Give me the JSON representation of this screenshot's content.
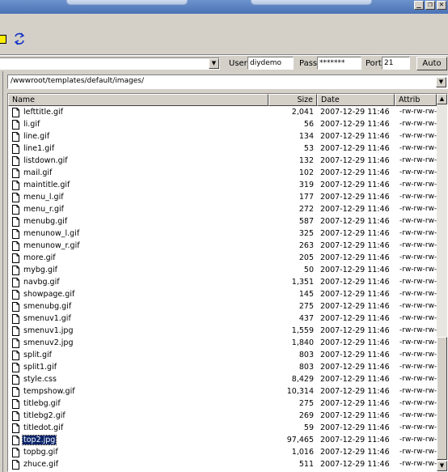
{
  "window": {
    "buttons": {
      "minimize": "_",
      "restore": "❐",
      "close": "✕"
    }
  },
  "connection": {
    "user_label": "User",
    "user_value": "diydemo",
    "pass_label": "Pass",
    "pass_value": "*******",
    "port_label": "Port",
    "port_value": "21",
    "auto_label": "Auto"
  },
  "path": {
    "value": "/wwwroot/templates/default/images/"
  },
  "columns": {
    "name": "Name",
    "size": "Size",
    "date": "Date",
    "attrib": "Attrib"
  },
  "files": [
    {
      "name": "lefttitle.gif",
      "size": "2,041",
      "date": "2007-12-29 11:46",
      "attrib": "-rw-rw-rw-"
    },
    {
      "name": "li.gif",
      "size": "56",
      "date": "2007-12-29 11:46",
      "attrib": "-rw-rw-rw-"
    },
    {
      "name": "line.gif",
      "size": "134",
      "date": "2007-12-29 11:46",
      "attrib": "-rw-rw-rw-"
    },
    {
      "name": "line1.gif",
      "size": "53",
      "date": "2007-12-29 11:46",
      "attrib": "-rw-rw-rw-"
    },
    {
      "name": "listdown.gif",
      "size": "132",
      "date": "2007-12-29 11:46",
      "attrib": "-rw-rw-rw-"
    },
    {
      "name": "mail.gif",
      "size": "102",
      "date": "2007-12-29 11:46",
      "attrib": "-rw-rw-rw-"
    },
    {
      "name": "maintitle.gif",
      "size": "319",
      "date": "2007-12-29 11:46",
      "attrib": "-rw-rw-rw-"
    },
    {
      "name": "menu_l.gif",
      "size": "177",
      "date": "2007-12-29 11:46",
      "attrib": "-rw-rw-rw-"
    },
    {
      "name": "menu_r.gif",
      "size": "272",
      "date": "2007-12-29 11:46",
      "attrib": "-rw-rw-rw-"
    },
    {
      "name": "menubg.gif",
      "size": "587",
      "date": "2007-12-29 11:46",
      "attrib": "-rw-rw-rw-"
    },
    {
      "name": "menunow_l.gif",
      "size": "325",
      "date": "2007-12-29 11:46",
      "attrib": "-rw-rw-rw-"
    },
    {
      "name": "menunow_r.gif",
      "size": "263",
      "date": "2007-12-29 11:46",
      "attrib": "-rw-rw-rw-"
    },
    {
      "name": "more.gif",
      "size": "205",
      "date": "2007-12-29 11:46",
      "attrib": "-rw-rw-rw-"
    },
    {
      "name": "mybg.gif",
      "size": "50",
      "date": "2007-12-29 11:46",
      "attrib": "-rw-rw-rw-"
    },
    {
      "name": "navbg.gif",
      "size": "1,351",
      "date": "2007-12-29 11:46",
      "attrib": "-rw-rw-rw-"
    },
    {
      "name": "showpage.gif",
      "size": "145",
      "date": "2007-12-29 11:46",
      "attrib": "-rw-rw-rw-"
    },
    {
      "name": "smenubg.gif",
      "size": "275",
      "date": "2007-12-29 11:46",
      "attrib": "-rw-rw-rw-"
    },
    {
      "name": "smenuv1.gif",
      "size": "437",
      "date": "2007-12-29 11:46",
      "attrib": "-rw-rw-rw-"
    },
    {
      "name": "smenuv1.jpg",
      "size": "1,559",
      "date": "2007-12-29 11:46",
      "attrib": "-rw-rw-rw-"
    },
    {
      "name": "smenuv2.jpg",
      "size": "1,840",
      "date": "2007-12-29 11:46",
      "attrib": "-rw-rw-rw-"
    },
    {
      "name": "split.gif",
      "size": "803",
      "date": "2007-12-29 11:46",
      "attrib": "-rw-rw-rw-"
    },
    {
      "name": "split1.gif",
      "size": "803",
      "date": "2007-12-29 11:46",
      "attrib": "-rw-rw-rw-"
    },
    {
      "name": "style.css",
      "size": "8,429",
      "date": "2007-12-29 11:46",
      "attrib": "-rw-rw-rw-"
    },
    {
      "name": "tempshow.gif",
      "size": "10,314",
      "date": "2007-12-29 11:46",
      "attrib": "-rw-rw-rw-"
    },
    {
      "name": "titlebg.gif",
      "size": "275",
      "date": "2007-12-29 11:46",
      "attrib": "-rw-rw-rw-"
    },
    {
      "name": "titlebg2.gif",
      "size": "269",
      "date": "2007-12-29 11:46",
      "attrib": "-rw-rw-rw-"
    },
    {
      "name": "titledot.gif",
      "size": "59",
      "date": "2007-12-29 11:46",
      "attrib": "-rw-rw-rw-"
    },
    {
      "name": "top2.jpg",
      "size": "97,465",
      "date": "2007-12-29 11:46",
      "attrib": "-rw-rw-rw-",
      "selected": true
    },
    {
      "name": "topbg.gif",
      "size": "1,016",
      "date": "2007-12-29 11:46",
      "attrib": "-rw-rw-rw-"
    },
    {
      "name": "zhuce.gif",
      "size": "511",
      "date": "2007-12-29 11:46",
      "attrib": "-rw-rw-rw-"
    }
  ],
  "colors": {
    "titlebar": "#4a72b6",
    "selection": "#0a246a",
    "chrome": "#d4d0c8"
  }
}
